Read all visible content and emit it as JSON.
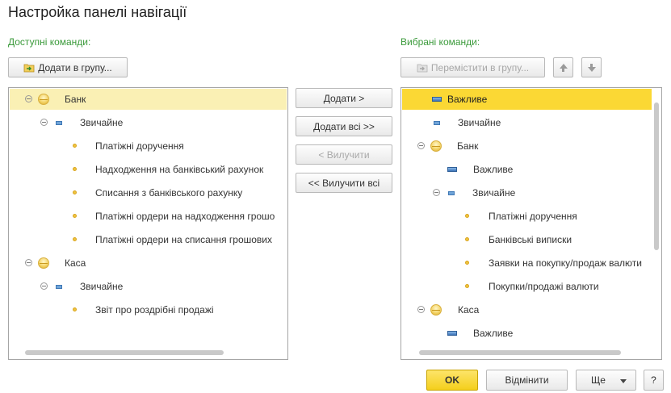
{
  "window": {
    "title": "Настройка панелі навігації"
  },
  "left": {
    "label": "Доступні команди:",
    "add_to_group": "Додати в групу...",
    "items": [
      {
        "text": "Банк",
        "kind": "group"
      },
      {
        "text": "Звичайне",
        "kind": "sub"
      },
      {
        "text": "Платіжні доручення",
        "kind": "item"
      },
      {
        "text": "Надходження на банківський рахунок",
        "kind": "item"
      },
      {
        "text": "Списання з банківського рахунку",
        "kind": "item"
      },
      {
        "text": "Платіжні ордери на надходження грошо",
        "kind": "item"
      },
      {
        "text": "Платіжні ордери на списання грошових",
        "kind": "item"
      },
      {
        "text": "Каса",
        "kind": "group"
      },
      {
        "text": "Звичайне",
        "kind": "sub"
      },
      {
        "text": "Звіт про роздрібні продажі",
        "kind": "item"
      }
    ]
  },
  "middle": {
    "add": "Додати >",
    "add_all": "Додати всі >>",
    "remove": "< Вилучити",
    "remove_all": "<< Вилучити всі"
  },
  "right": {
    "label": "Вибрані команди:",
    "move_to_group": "Перемістити в групу...",
    "items": [
      {
        "text": "Важливе",
        "kind": "important"
      },
      {
        "text": "Звичайне",
        "kind": "sub"
      },
      {
        "text": "Банк",
        "kind": "group"
      },
      {
        "text": "Важливе",
        "kind": "important"
      },
      {
        "text": "Звичайне",
        "kind": "sub"
      },
      {
        "text": "Платіжні доручення",
        "kind": "item"
      },
      {
        "text": "Банківські виписки",
        "kind": "item"
      },
      {
        "text": "Заявки на покупку/продаж валюти",
        "kind": "item"
      },
      {
        "text": "Покупки/продажі валюти",
        "kind": "item"
      },
      {
        "text": "Каса",
        "kind": "group"
      },
      {
        "text": "Важливе",
        "kind": "important"
      }
    ]
  },
  "footer": {
    "ok": "OK",
    "cancel": "Відмінити",
    "more": "Ще",
    "help": "?"
  }
}
